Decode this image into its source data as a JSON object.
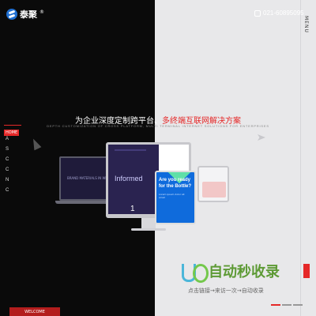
{
  "header": {
    "logo_text": "泰聚",
    "logo_reg": "®",
    "phone": "021-60895095",
    "menu_label": "MENU"
  },
  "hero": {
    "headline_part1": "为企业深度定制跨平台、",
    "headline_part2": "多终端互联网解决方案",
    "subline": "DEPTH CUSTOMIZATION OF CROSS PLATFORM, MULTI TERMINAL INTERNET SOLUTIONS FOR ENTERPRISES"
  },
  "side_nav": {
    "active": "HOME",
    "letters": [
      "A",
      "S",
      "C",
      "C",
      "N",
      "C"
    ]
  },
  "welcome_button": "WELCOME",
  "devices": {
    "laptop_text": "BRAND MATERIALS IN WEB",
    "monitor_title": "Informed",
    "monitor_number": "1",
    "phone_question": "Are you ready for the Bottle?",
    "phone_small": "Lorem ipsum dolor sit amet"
  },
  "watermark": {
    "title": "自动秒收录",
    "subtitle": "点击链接→来访一次→自动收录"
  },
  "colors": {
    "accent": "#e52828",
    "dark": "#0a0a0a",
    "light": "#e8e8ea"
  }
}
